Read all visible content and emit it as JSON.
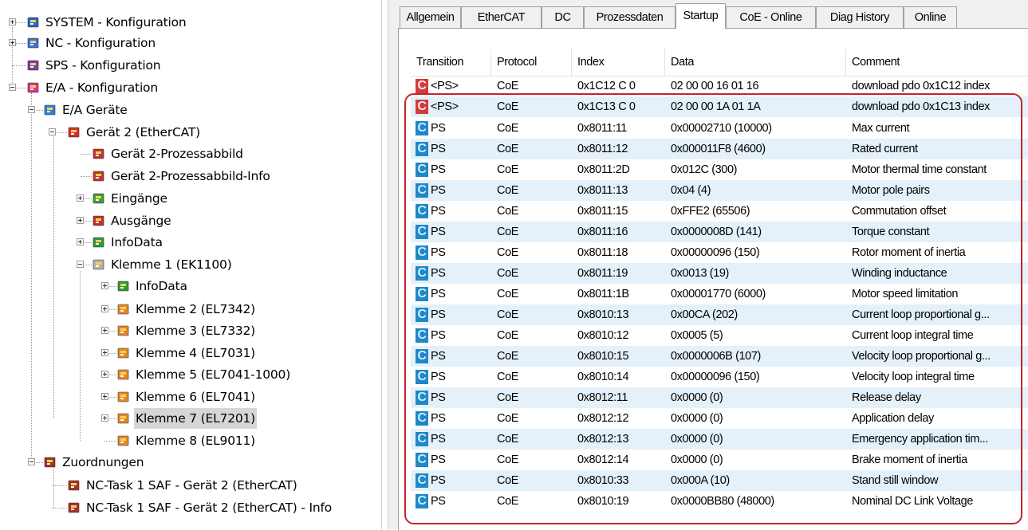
{
  "tree": [
    {
      "label": "SYSTEM - Konfiguration",
      "icon": "system-config-icon",
      "expander": "plus"
    },
    {
      "label": "NC - Konfiguration",
      "icon": "nc-config-icon",
      "expander": "plus"
    },
    {
      "label": "SPS - Konfiguration",
      "icon": "plc-config-icon",
      "expander": "none"
    },
    {
      "label": "E/A - Konfiguration",
      "icon": "io-config-icon",
      "expander": "minus"
    },
    {
      "label": "E/A Geräte",
      "icon": "io-devices-icon",
      "expander": "minus"
    },
    {
      "label": "Gerät 2 (EtherCAT)",
      "icon": "ethercat-device-icon",
      "expander": "minus"
    },
    {
      "label": "Gerät 2-Prozessabbild",
      "icon": "process-image-icon",
      "expander": "none"
    },
    {
      "label": "Gerät 2-Prozessabbild-Info",
      "icon": "process-image-icon",
      "expander": "none"
    },
    {
      "label": "Eingänge",
      "icon": "inputs-icon",
      "expander": "plus"
    },
    {
      "label": "Ausgänge",
      "icon": "outputs-icon",
      "expander": "plus"
    },
    {
      "label": "InfoData",
      "icon": "infodata-icon",
      "expander": "plus"
    },
    {
      "label": "Klemme 1 (EK1100)",
      "icon": "coupler-icon",
      "expander": "minus"
    },
    {
      "label": "InfoData",
      "icon": "infodata-icon",
      "expander": "plus"
    },
    {
      "label": "Klemme 2 (EL7342)",
      "icon": "terminal-icon",
      "expander": "plus"
    },
    {
      "label": "Klemme 3 (EL7332)",
      "icon": "terminal-icon",
      "expander": "plus"
    },
    {
      "label": "Klemme 4 (EL7031)",
      "icon": "terminal-icon",
      "expander": "plus"
    },
    {
      "label": "Klemme 5 (EL7041-1000)",
      "icon": "terminal-icon",
      "expander": "plus"
    },
    {
      "label": "Klemme 6 (EL7041)",
      "icon": "terminal-icon",
      "expander": "plus"
    },
    {
      "label": "Klemme 7 (EL7201)",
      "icon": "terminal-icon",
      "expander": "plus",
      "selected": true
    },
    {
      "label": "Klemme 8 (EL9011)",
      "icon": "end-terminal-icon",
      "expander": "none"
    },
    {
      "label": "Zuordnungen",
      "icon": "mappings-icon",
      "expander": "minus"
    },
    {
      "label": "NC-Task 1 SAF - Gerät 2 (EtherCAT)",
      "icon": "mapping-item-icon",
      "expander": "none"
    },
    {
      "label": "NC-Task 1 SAF - Gerät 2 (EtherCAT) - Info",
      "icon": "mapping-item-icon",
      "expander": "none"
    }
  ],
  "tabs": [
    {
      "label": "Allgemein",
      "active": false
    },
    {
      "label": "EtherCAT",
      "active": false
    },
    {
      "label": "DC",
      "active": false
    },
    {
      "label": "Prozessdaten",
      "active": false
    },
    {
      "label": "Startup",
      "active": true
    },
    {
      "label": "CoE - Online",
      "active": false
    },
    {
      "label": "Diag History",
      "active": false
    },
    {
      "label": "Online",
      "active": false
    }
  ],
  "columns": [
    "Transition",
    "Protocol",
    "Index",
    "Data",
    "Comment"
  ],
  "rows": [
    {
      "icon": "C",
      "transition": "<PS>",
      "protocol": "CoE",
      "index": "0x1C12 C 0",
      "data": "02 00 00 16 01 16",
      "comment": "download pdo 0x1C12 index"
    },
    {
      "icon": "C",
      "transition": "<PS>",
      "protocol": "CoE",
      "index": "0x1C13 C 0",
      "data": "02 00 00 1A 01 1A",
      "comment": "download pdo 0x1C13 index"
    },
    {
      "icon": "C",
      "transition": "PS",
      "protocol": "CoE",
      "index": "0x8011:11",
      "data": "0x00002710 (10000)",
      "comment": "Max current"
    },
    {
      "icon": "C",
      "transition": "PS",
      "protocol": "CoE",
      "index": "0x8011:12",
      "data": "0x000011F8 (4600)",
      "comment": "Rated current"
    },
    {
      "icon": "C",
      "transition": "PS",
      "protocol": "CoE",
      "index": "0x8011:2D",
      "data": "0x012C (300)",
      "comment": "Motor thermal time constant"
    },
    {
      "icon": "C",
      "transition": "PS",
      "protocol": "CoE",
      "index": "0x8011:13",
      "data": "0x04 (4)",
      "comment": "Motor pole pairs"
    },
    {
      "icon": "C",
      "transition": "PS",
      "protocol": "CoE",
      "index": "0x8011:15",
      "data": "0xFFE2 (65506)",
      "comment": "Commutation offset"
    },
    {
      "icon": "C",
      "transition": "PS",
      "protocol": "CoE",
      "index": "0x8011:16",
      "data": "0x0000008D (141)",
      "comment": "Torque constant"
    },
    {
      "icon": "C",
      "transition": "PS",
      "protocol": "CoE",
      "index": "0x8011:18",
      "data": "0x00000096 (150)",
      "comment": "Rotor moment of inertia"
    },
    {
      "icon": "C",
      "transition": "PS",
      "protocol": "CoE",
      "index": "0x8011:19",
      "data": "0x0013 (19)",
      "comment": "Winding inductance"
    },
    {
      "icon": "C",
      "transition": "PS",
      "protocol": "CoE",
      "index": "0x8011:1B",
      "data": "0x00001770 (6000)",
      "comment": "Motor speed limitation"
    },
    {
      "icon": "C",
      "transition": "PS",
      "protocol": "CoE",
      "index": "0x8010:13",
      "data": "0x00CA (202)",
      "comment": "Current loop proportional g..."
    },
    {
      "icon": "C",
      "transition": "PS",
      "protocol": "CoE",
      "index": "0x8010:12",
      "data": "0x0005 (5)",
      "comment": "Current loop integral time"
    },
    {
      "icon": "C",
      "transition": "PS",
      "protocol": "CoE",
      "index": "0x8010:15",
      "data": "0x0000006B (107)",
      "comment": "Velocity loop proportional g..."
    },
    {
      "icon": "C",
      "transition": "PS",
      "protocol": "CoE",
      "index": "0x8010:14",
      "data": "0x00000096 (150)",
      "comment": "Velocity loop integral time"
    },
    {
      "icon": "C",
      "transition": "PS",
      "protocol": "CoE",
      "index": "0x8012:11",
      "data": "0x0000 (0)",
      "comment": "Release delay"
    },
    {
      "icon": "C",
      "transition": "PS",
      "protocol": "CoE",
      "index": "0x8012:12",
      "data": "0x0000 (0)",
      "comment": "Application delay"
    },
    {
      "icon": "C",
      "transition": "PS",
      "protocol": "CoE",
      "index": "0x8012:13",
      "data": "0x0000 (0)",
      "comment": "Emergency application tim..."
    },
    {
      "icon": "C",
      "transition": "PS",
      "protocol": "CoE",
      "index": "0x8012:14",
      "data": "0x0000 (0)",
      "comment": "Brake moment of inertia"
    },
    {
      "icon": "C",
      "transition": "PS",
      "protocol": "CoE",
      "index": "0x8010:33",
      "data": "0x000A (10)",
      "comment": "Stand still window"
    },
    {
      "icon": "C",
      "transition": "PS",
      "protocol": "CoE",
      "index": "0x8010:19",
      "data": "0x0000BB80 (48000)",
      "comment": "Nominal DC Link Voltage"
    }
  ],
  "colors": {
    "highlight_border": "#c5242b",
    "row_alt": "#e4f1fa",
    "icon_ps": "#1e88c8",
    "icon_pre": "#d33b3b"
  }
}
